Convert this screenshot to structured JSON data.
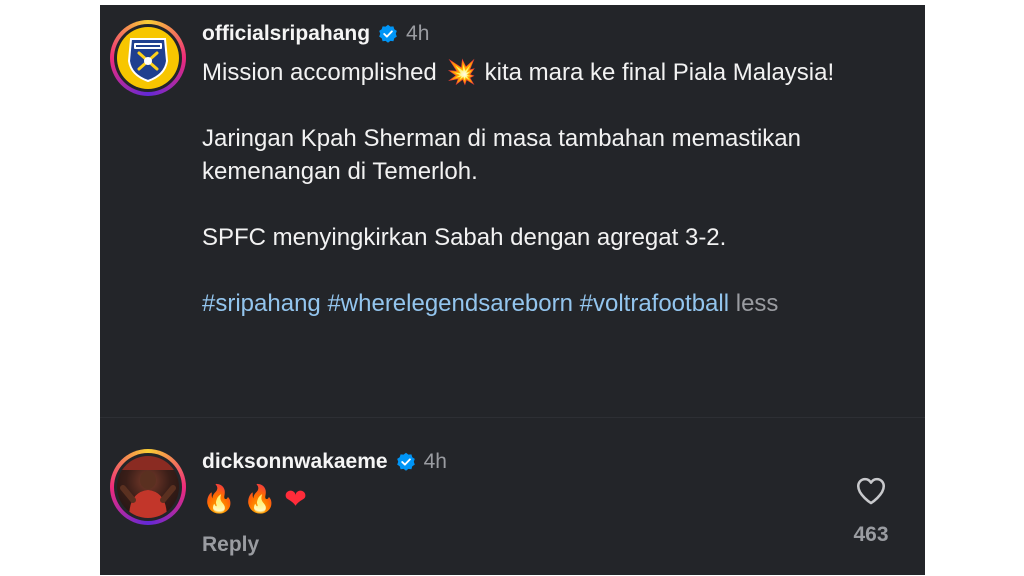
{
  "post": {
    "username": "officialsripahang",
    "time": "4h",
    "caption": {
      "line1_before": "Mission accomplished",
      "line1_emoji": "💥",
      "line1_after": "kita mara ke final Piala Malaysia!",
      "paragraph2": "Jaringan Kpah Sherman di masa tambahan memastikan kemenangan di Temerloh.",
      "paragraph3": "SPFC menyingkirkan Sabah dengan agregat 3-2.",
      "hashtags": [
        "#sripahang",
        "#wherelegendsareborn",
        "#voltrafootball"
      ],
      "less_label": "less"
    }
  },
  "comment": {
    "username": "dicksonnwakaeme",
    "time": "4h",
    "emoji_fire1": "🔥",
    "emoji_fire2": "🔥",
    "emoji_heart": "❤",
    "reply_label": "Reply",
    "like_count": "463"
  },
  "icons": {
    "verified": "verified-badge-icon",
    "like": "heart-outline-icon"
  },
  "colors": {
    "background": "#232529",
    "hashtag": "#93c5ee",
    "verified": "#0095f6",
    "muted_text": "#9a9ca1"
  }
}
